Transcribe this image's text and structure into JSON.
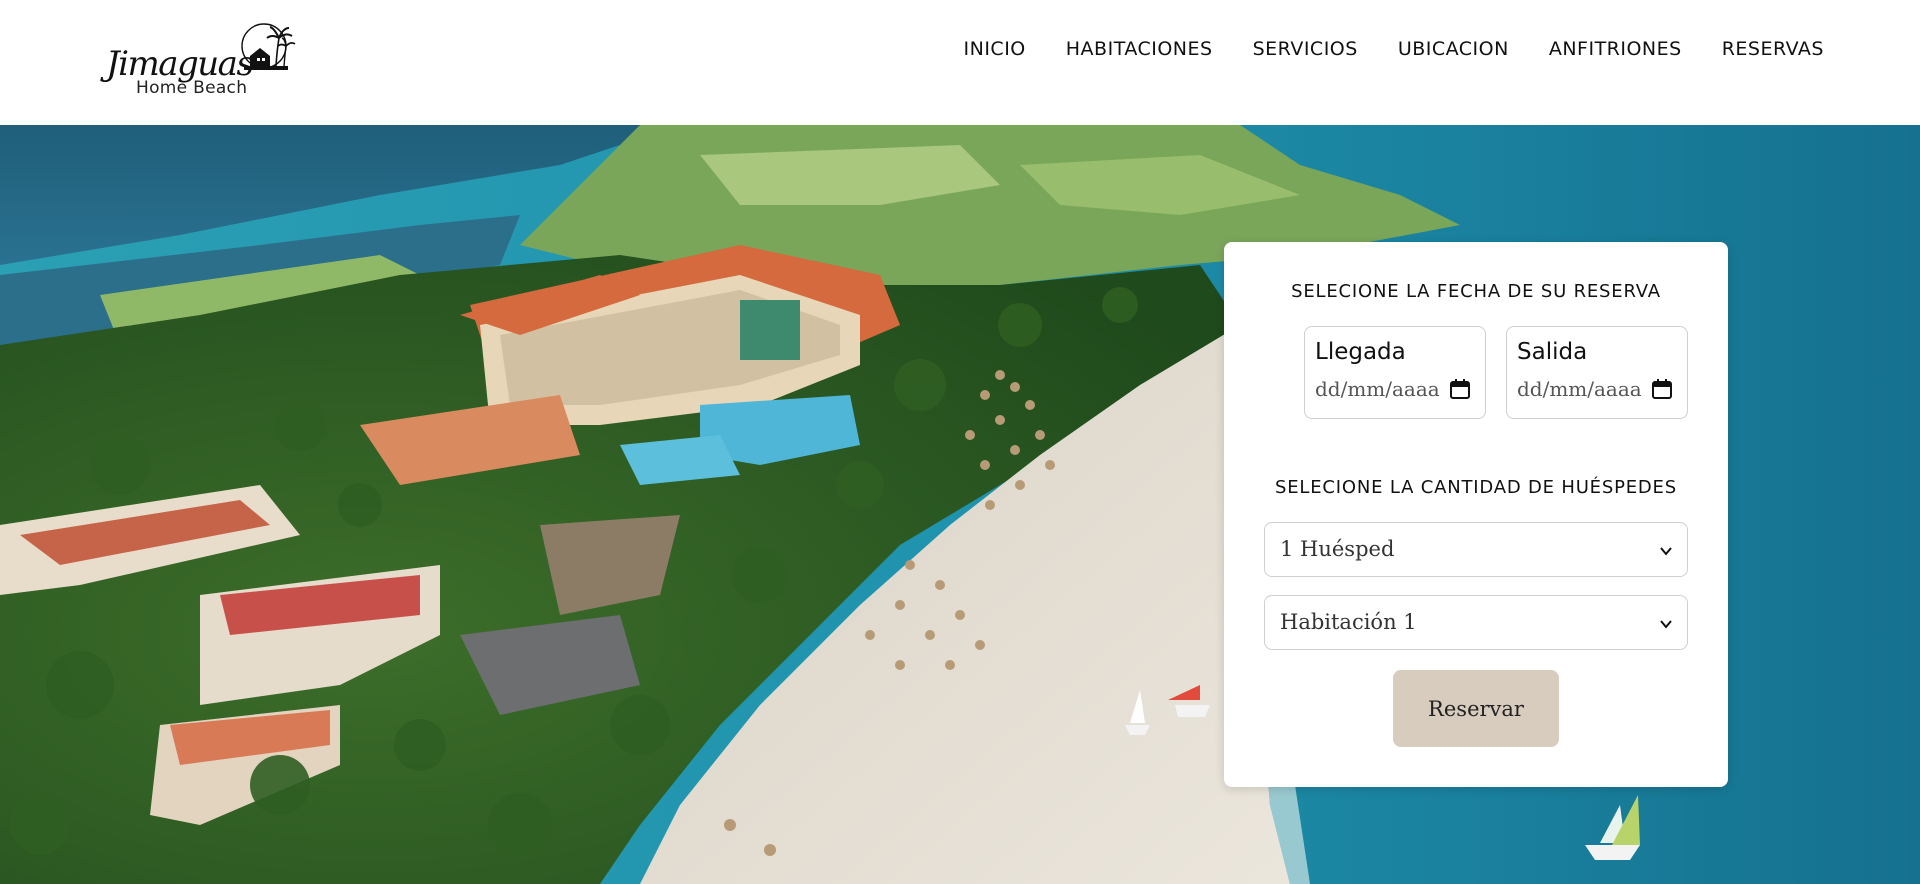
{
  "brand": {
    "name": "Jimaguas",
    "tagline": "Home Beach",
    "icon": "palm-house-sun-logo"
  },
  "nav": {
    "items": [
      {
        "label": "INICIO"
      },
      {
        "label": "HABITACIONES"
      },
      {
        "label": "SERVICIOS"
      },
      {
        "label": "UBICACION"
      },
      {
        "label": "ANFITRIONES"
      },
      {
        "label": "RESERVAS"
      }
    ]
  },
  "hero": {
    "image": "aerial-beach-resort-photo"
  },
  "booking": {
    "date_title": "SELECIONE LA FECHA DE SU RESERVA",
    "arrival_label": "Llegada",
    "arrival_placeholder": "dd/mm/aaaa",
    "departure_label": "Salida",
    "departure_placeholder": "dd/mm/aaaa",
    "guests_title": "SELECIONE LA CANTIDAD DE HUÉSPEDES",
    "guests_selected": "1 Huésped",
    "room_selected": "Habitación 1",
    "reserve_label": "Reservar",
    "reserve_color": "#d8ccbf"
  }
}
